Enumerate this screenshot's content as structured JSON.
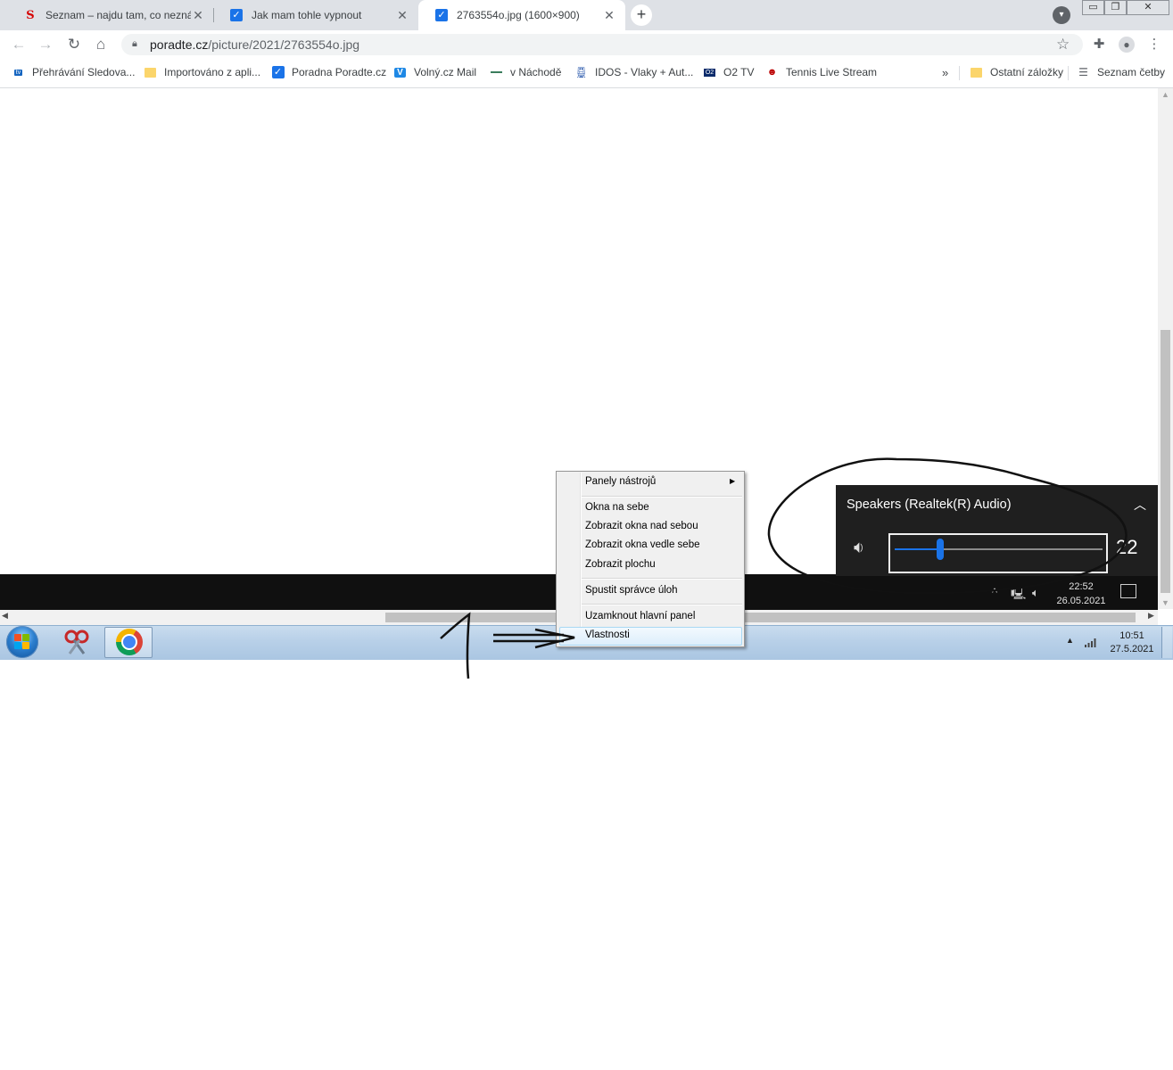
{
  "tabs": [
    {
      "title": "Seznam – najdu tam, co neznám",
      "active": false
    },
    {
      "title": "Jak mam tohle vypnout",
      "active": false
    },
    {
      "title": "2763554o.jpg (1600×900)",
      "active": true
    }
  ],
  "address_bar": {
    "host": "poradte.cz",
    "path": "/picture/2021/2763554o.jpg"
  },
  "bookmarks": [
    {
      "label": "Přehrávání  Sledova...",
      "icon": "tv-icon"
    },
    {
      "label": "Importováno z apli...",
      "icon": "folder-icon"
    },
    {
      "label": "Poradna Poradte.cz",
      "icon": "check-icon"
    },
    {
      "label": "Volný.cz Mail",
      "icon": "v-icon"
    },
    {
      "label": "v Náchodě",
      "icon": "dash-icon"
    },
    {
      "label": "IDOS - Vlaky + Aut...",
      "icon": "train-icon"
    },
    {
      "label": "O2 TV",
      "icon": "o2-icon"
    },
    {
      "label": "Tennis Live Stream",
      "icon": "mask-icon"
    }
  ],
  "bookmarks_right": [
    {
      "label": "Ostatní záložky",
      "icon": "folder-icon"
    },
    {
      "label": "Seznam četby",
      "icon": "reading-list-icon"
    }
  ],
  "volume_flyout": {
    "device": "Speakers (Realtek(R) Audio)",
    "level": 22
  },
  "inner_taskbar": {
    "time": "22:52",
    "date": "26.05.2021"
  },
  "context_menu": {
    "items": [
      {
        "label": "Panely nástrojů",
        "submenu": true
      },
      {
        "label": "Okna na sebe"
      },
      {
        "label": "Zobrazit okna nad sebou"
      },
      {
        "label": "Zobrazit okna vedle sebe"
      },
      {
        "label": "Zobrazit plochu"
      },
      {
        "label": "Spustit správce úloh"
      },
      {
        "label": "Uzamknout hlavní panel"
      },
      {
        "label": "Vlastnosti",
        "highlighted": true
      }
    ]
  },
  "win7_taskbar": {
    "time": "10:51",
    "date": "27.5.2021"
  },
  "scroll": {
    "horizontal_thumb_start": 0.33,
    "horizontal_thumb_size": 0.66
  },
  "colors": {
    "volume_accent": "#1a73e8",
    "annotation_ink": "#111111"
  }
}
